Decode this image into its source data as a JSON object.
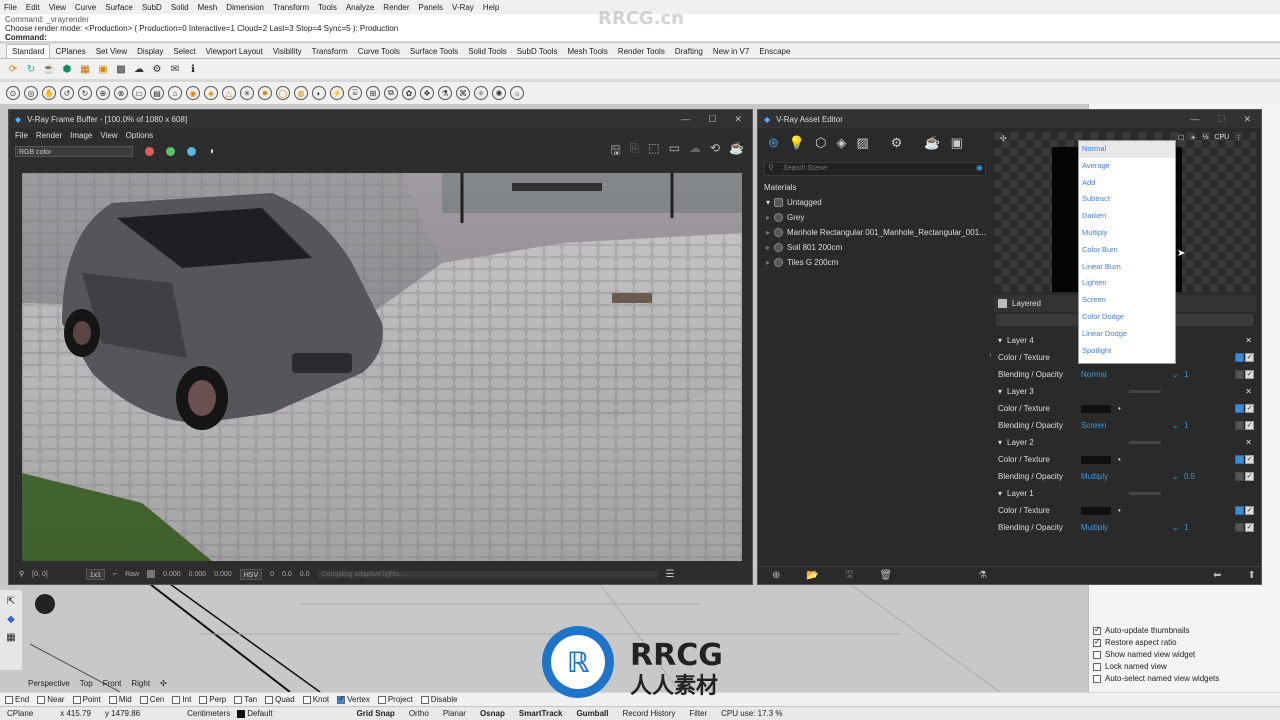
{
  "menu": [
    "File",
    "Edit",
    "View",
    "Curve",
    "Surface",
    "SubD",
    "Solid",
    "Mesh",
    "Dimension",
    "Transform",
    "Tools",
    "Analyze",
    "Render",
    "Panels",
    "V-Ray",
    "Help"
  ],
  "command_history": {
    "line1": "Command: _vrayrender",
    "line2": "Choose render mode: <Production> ( Production=0 Interactive=1 Cloud=2 Last=3 Stop=4 Sync=5 ): Production",
    "prompt": "Command:"
  },
  "watermark_top": "RRCG.cn",
  "toolbar_tabs": [
    "Standard",
    "CPlanes",
    "Set View",
    "Display",
    "Select",
    "Viewport Layout",
    "Visibility",
    "Transform",
    "Curve Tools",
    "Surface Tools",
    "Solid Tools",
    "SubD Tools",
    "Mesh Tools",
    "Render Tools",
    "Drafting",
    "New in V7",
    "Enscape"
  ],
  "frame_buffer": {
    "title": "V-Ray Frame Buffer - [100.0% of 1080 x 608]",
    "menu": [
      "File",
      "Render",
      "Image",
      "View",
      "Options"
    ],
    "channel": "RGB color",
    "coords": "[0, 0]",
    "zoom": "1x1",
    "raw_label": "Raw",
    "raw_values": [
      "0.000",
      "0.000",
      "0.000"
    ],
    "color_mode": "HSV",
    "hsv_values": [
      "0",
      "0.0",
      "0.0"
    ],
    "progress_text": "Compiling adaptive lights..."
  },
  "asset_editor": {
    "title": "V-Ray Asset Editor",
    "search_placeholder": "Search Scene",
    "section": "Materials",
    "materials": [
      "Untagged",
      "Grey",
      "Manhole Rectangular 001_Manhole_Rectangular_001...",
      "Soil 801 200cm",
      "Tiles G 200cm"
    ],
    "cpu_label": "CPU",
    "layered_title": "Layered",
    "blend_modes": [
      "Normal",
      "Average",
      "Add",
      "Subtract",
      "Darken",
      "Multiply",
      "Color Burn",
      "Linear Burn",
      "Lighten",
      "Screen",
      "Color Dodge",
      "Linear Dodge",
      "Spotlight"
    ],
    "layers": [
      {
        "name": "Layer 4",
        "color_label": "Color / Texture",
        "blend_label": "Blending / Opacity",
        "blend": "Normal",
        "opacity": "1"
      },
      {
        "name": "Layer 3",
        "color_label": "Color / Texture",
        "blend_label": "Blending / Opacity",
        "blend": "Screen",
        "opacity": "1"
      },
      {
        "name": "Layer 2",
        "color_label": "Color / Texture",
        "blend_label": "Blending / Opacity",
        "blend": "Multiply",
        "opacity": "0.5"
      },
      {
        "name": "Layer 1",
        "color_label": "Color / Texture",
        "blend_label": "Blending / Opacity",
        "blend": "Multiply",
        "opacity": "1"
      }
    ]
  },
  "right_panel": {
    "options": [
      {
        "label": "Auto-update thumbnails",
        "checked": true
      },
      {
        "label": "Restore aspect ratio",
        "checked": true
      },
      {
        "label": "Show named view widget",
        "checked": false
      },
      {
        "label": "Lock named view",
        "checked": false
      },
      {
        "label": "Auto-select named view widgets",
        "checked": false
      }
    ]
  },
  "viewport_tabs": [
    "Perspective",
    "Top",
    "Front",
    "Right"
  ],
  "osnaps": [
    {
      "label": "End",
      "checked": false
    },
    {
      "label": "Near",
      "checked": false
    },
    {
      "label": "Point",
      "checked": false
    },
    {
      "label": "Mid",
      "checked": false
    },
    {
      "label": "Cen",
      "checked": false
    },
    {
      "label": "Int",
      "checked": false
    },
    {
      "label": "Perp",
      "checked": false
    },
    {
      "label": "Tan",
      "checked": false
    },
    {
      "label": "Quad",
      "checked": false
    },
    {
      "label": "Knot",
      "checked": false
    },
    {
      "label": "Vertex",
      "checked": true
    },
    {
      "label": "Project",
      "checked": false
    },
    {
      "label": "Disable",
      "checked": false
    }
  ],
  "status": {
    "cplane": "CPlane",
    "x": "x 415.79",
    "y": "y 1479.86",
    "units": "Centimeters",
    "layer": "Default",
    "grid_snap": "Grid Snap",
    "ortho": "Ortho",
    "planar": "Planar",
    "osnap": "Osnap",
    "smarttrack": "SmartTrack",
    "gumball": "Gumball",
    "record_history": "Record History",
    "filter": "Filter",
    "cpu": "CPU use: 17.3 %"
  },
  "logo": {
    "text1": "RRCG",
    "text2": "人人素材"
  },
  "colors": {
    "accent": "#3b9be0",
    "vray_dark": "#2a2a2a"
  }
}
